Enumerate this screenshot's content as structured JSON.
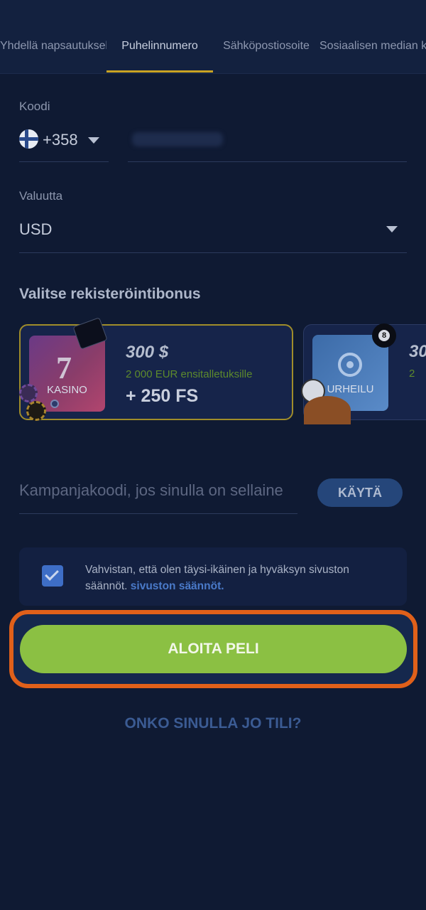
{
  "tabs": [
    {
      "label": "Yhdellä napsautuksella"
    },
    {
      "label": "Puhelinnumero"
    },
    {
      "label": "Sähköpostiosoite"
    },
    {
      "label": "Sosiaalisen median kautta"
    }
  ],
  "phone": {
    "code_label": "Koodi",
    "code_value": "+358",
    "country_flag": "finland-flag"
  },
  "currency": {
    "label": "Valuutta",
    "value": "USD"
  },
  "bonus": {
    "title": "Valitse rekisteröintibonus",
    "cards": [
      {
        "tile_label": "KASINO",
        "amount": "300 $",
        "sub": "2 000 EUR ensitalletuksille",
        "extra": "+ 250 FS",
        "selected": true
      },
      {
        "tile_label": "URHEILU",
        "amount": "30",
        "sub": "2",
        "selected": false
      }
    ]
  },
  "promo": {
    "placeholder": "Kampanjakoodi, jos sinulla on sellaine",
    "apply_label": "KÄYTÄ"
  },
  "terms": {
    "text": "Vahvistan, että olen täysi-ikäinen ja hyväksyn sivuston säännöt.",
    "link": "sivuston säännöt.",
    "checked": true
  },
  "cta": {
    "label": "ALOITA PELI"
  },
  "login": {
    "label": "ONKO SINULLA JO TILI?"
  },
  "colors": {
    "background": "#0f1a33",
    "accent_gold": "#c9a323",
    "cta_green": "#8bc043",
    "highlight_orange": "#e0601a",
    "link_blue": "#4a7ac9"
  }
}
